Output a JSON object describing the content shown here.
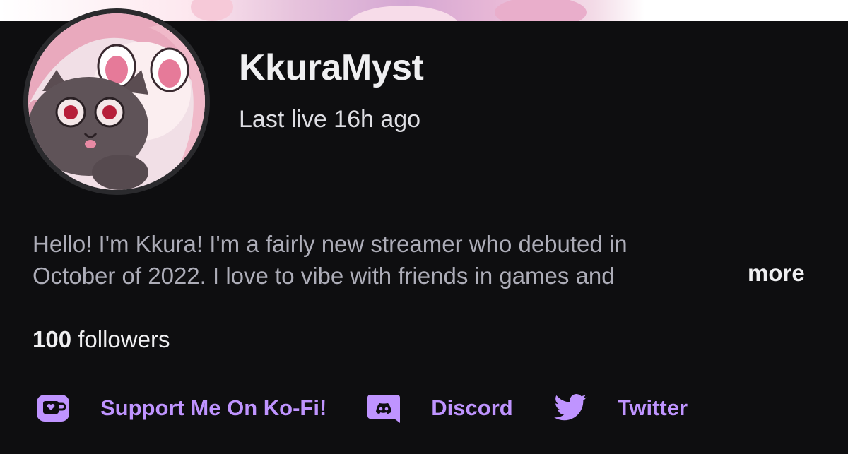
{
  "profile": {
    "username": "KkuraMyst",
    "last_live": "Last live 16h ago",
    "bio_line1": "Hello! I'm Kkura! I'm a fairly new streamer who debuted in",
    "bio_line2": "October of 2022. I love to vibe with friends in games and",
    "more_label": "more",
    "followers_count": "100",
    "followers_label": "followers"
  },
  "links": [
    {
      "label": "Support Me On Ko-Fi!",
      "icon": "kofi-icon"
    },
    {
      "label": "Discord",
      "icon": "discord-icon"
    },
    {
      "label": "Twitter",
      "icon": "twitter-icon"
    }
  ],
  "colors": {
    "background": "#0e0e10",
    "accent": "#bf94ff",
    "text_primary": "#efeff1",
    "text_secondary": "#adadb8"
  }
}
